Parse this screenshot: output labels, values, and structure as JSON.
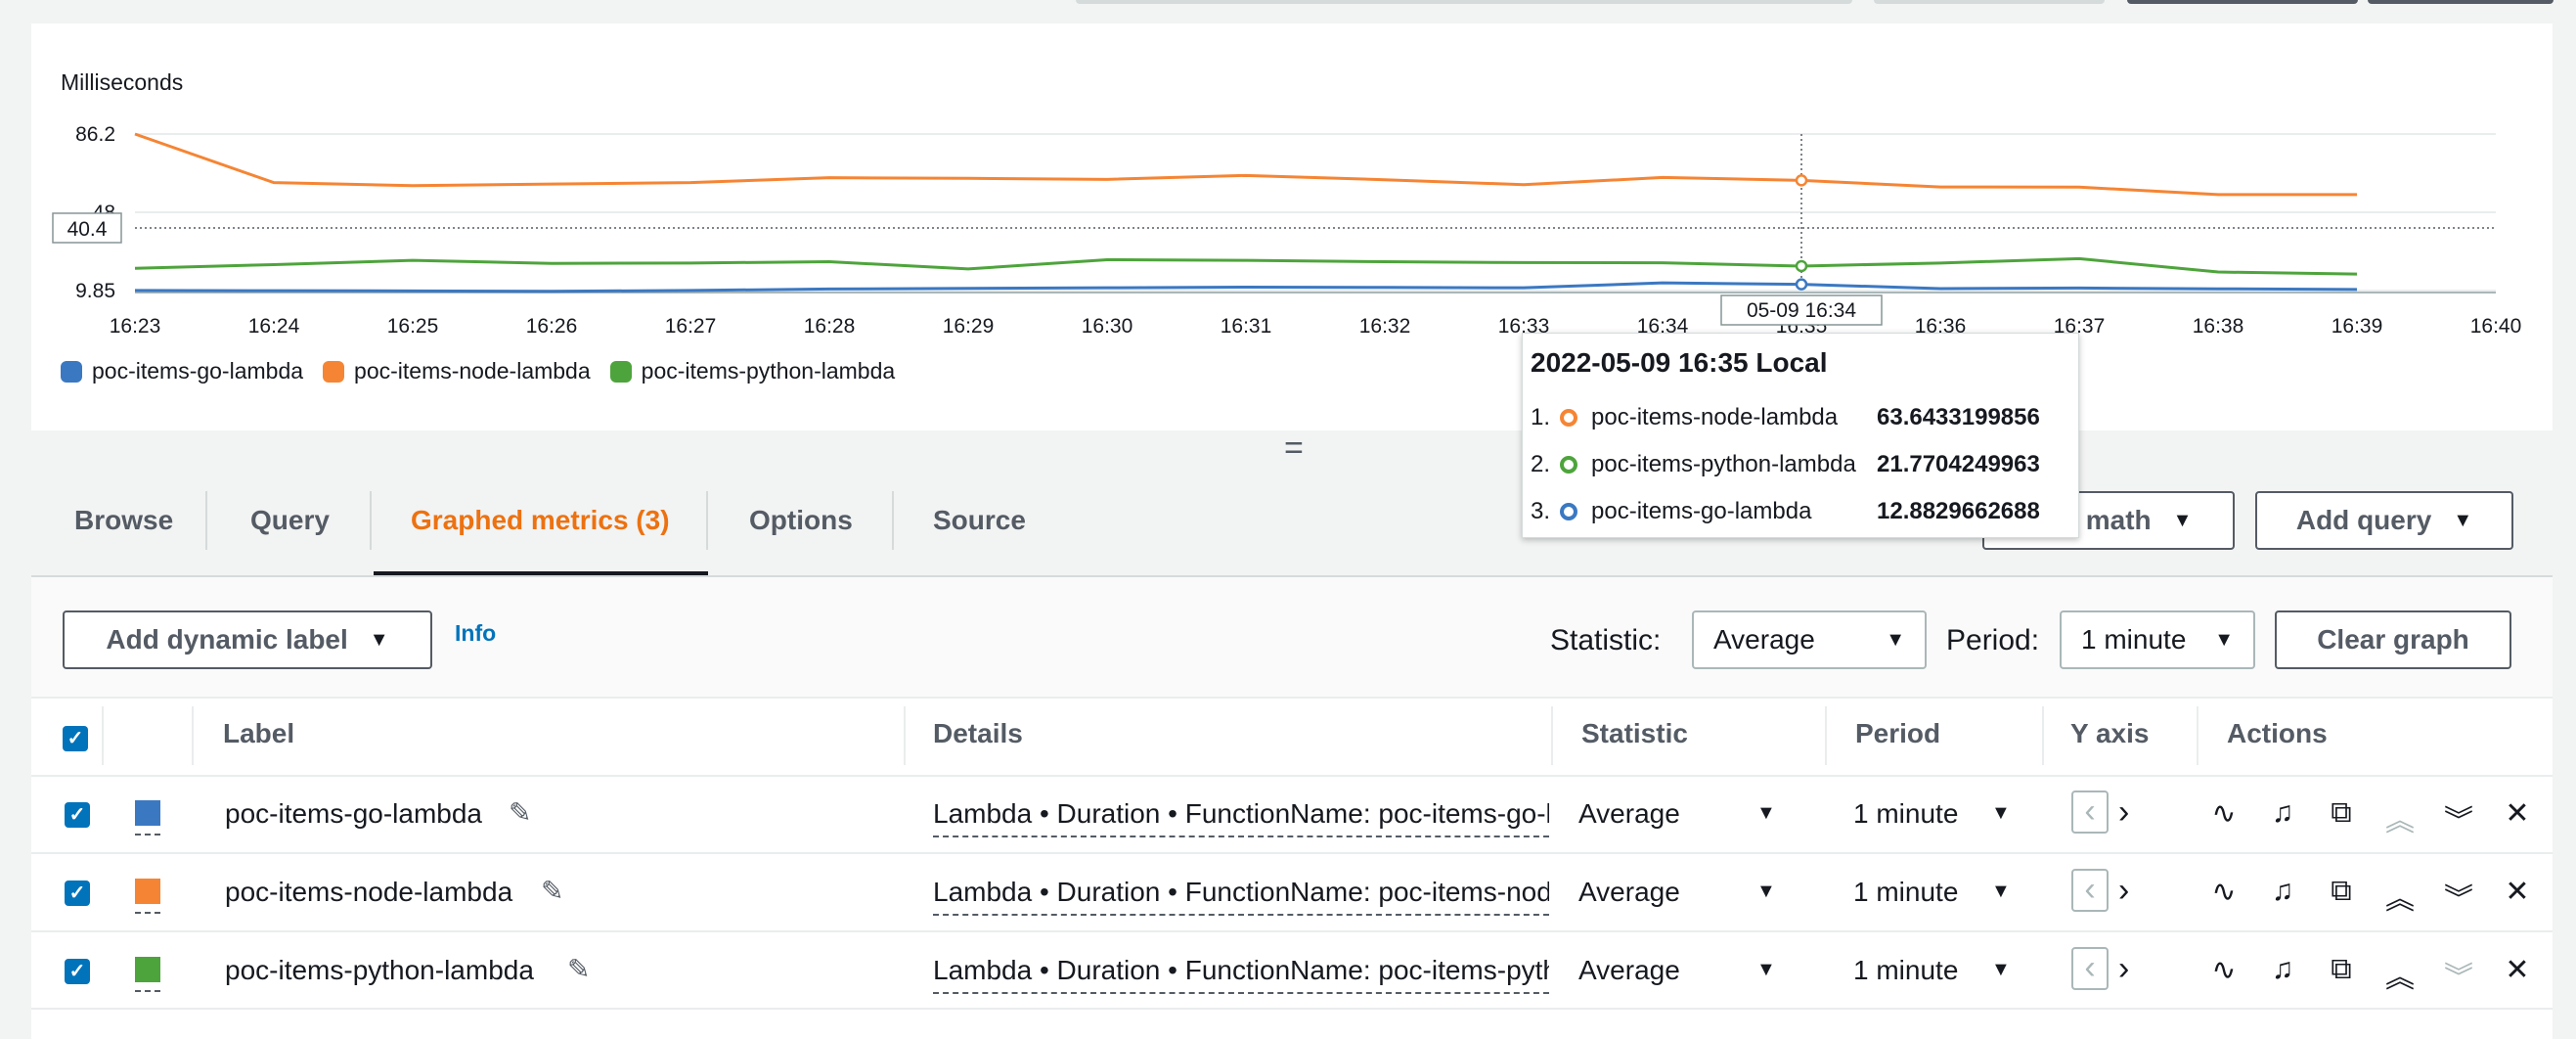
{
  "chart_data": {
    "type": "line",
    "ylabel": "Milliseconds",
    "y_ticks": [
      "86.2",
      "48",
      "9.85"
    ],
    "y_crosshair_label": "40.4",
    "x_ticks": [
      "16:23",
      "16:24",
      "16:25",
      "16:26",
      "16:27",
      "16:28",
      "16:29",
      "16:30",
      "16:31",
      "16:32",
      "16:33",
      "16:34",
      "16:35",
      "16:36",
      "16:37",
      "16:38",
      "16:39",
      "16:40"
    ],
    "x_crosshair_label": "05-09 16:34",
    "ylim": [
      9.85,
      86.2
    ],
    "grid": true,
    "legend_position": "bottom-left",
    "series": [
      {
        "name": "poc-items-go-lambda",
        "color": "#3b78c2",
        "values": [
          9.9,
          9.8,
          9.7,
          9.5,
          9.9,
          10.6,
          10.9,
          11.2,
          11.5,
          11.4,
          11.2,
          13.6,
          12.9,
          10.8,
          11.1,
          10.7,
          10.4
        ]
      },
      {
        "name": "poc-items-node-lambda",
        "color": "#f58534",
        "values": [
          86.2,
          62.5,
          61,
          61.8,
          62.5,
          64.9,
          64.6,
          64.1,
          66,
          63.9,
          61.5,
          65,
          63.6,
          60.4,
          60.3,
          56.7,
          56.7
        ]
      },
      {
        "name": "poc-items-python-lambda",
        "color": "#4ea43c",
        "values": [
          20.7,
          22.5,
          24.6,
          23.1,
          23.3,
          23.9,
          20.4,
          24.9,
          24.6,
          23.9,
          23.5,
          23.4,
          21.8,
          23.3,
          25.4,
          18.9,
          17.9
        ]
      }
    ]
  },
  "tooltip": {
    "title": "2022-05-09 16:35 Local",
    "rows": [
      {
        "num": "1.",
        "name": "poc-items-node-lambda",
        "value": "63.6433199856",
        "color": "#f58534"
      },
      {
        "num": "2.",
        "name": "poc-items-python-lambda",
        "value": "21.7704249963",
        "color": "#4ea43c"
      },
      {
        "num": "3.",
        "name": "poc-items-go-lambda",
        "value": "12.8829662688",
        "color": "#3b78c2"
      }
    ]
  },
  "tabs": {
    "browse": "Browse",
    "query": "Query",
    "graphed": "Graphed metrics (3)",
    "options": "Options",
    "source": "Source"
  },
  "toolbar": {
    "add_math": "Add math",
    "add_query": "Add query",
    "add_dynamic_label": "Add dynamic label",
    "info": "Info",
    "statistic_label": "Statistic:",
    "statistic_value": "Average",
    "period_label": "Period:",
    "period_value": "1 minute",
    "clear_graph": "Clear graph"
  },
  "table": {
    "headers": {
      "label": "Label",
      "details": "Details",
      "statistic": "Statistic",
      "period": "Period",
      "yaxis": "Y axis",
      "actions": "Actions"
    },
    "rows": [
      {
        "label": "poc-items-go-lambda",
        "details": "Lambda • Duration • FunctionName: poc-items-go-lambda",
        "statistic": "Average",
        "period": "1 minute",
        "color": "#3b78c2"
      },
      {
        "label": "poc-items-node-lambda",
        "details": "Lambda • Duration • FunctionName: poc-items-node-lambda",
        "statistic": "Average",
        "period": "1 minute",
        "color": "#f58534"
      },
      {
        "label": "poc-items-python-lambda",
        "details": "Lambda • Duration • FunctionName: poc-items-python-lambda",
        "statistic": "Average",
        "period": "1 minute",
        "color": "#4ea43c"
      }
    ]
  },
  "icons": {
    "check": "✓",
    "edit": "✎",
    "caret": "▼",
    "y_left": "‹",
    "y_right": "›",
    "pulse": "∿",
    "bell": "♫",
    "copy": "⧉",
    "up": "︽",
    "down": "︾",
    "close": "✕"
  }
}
